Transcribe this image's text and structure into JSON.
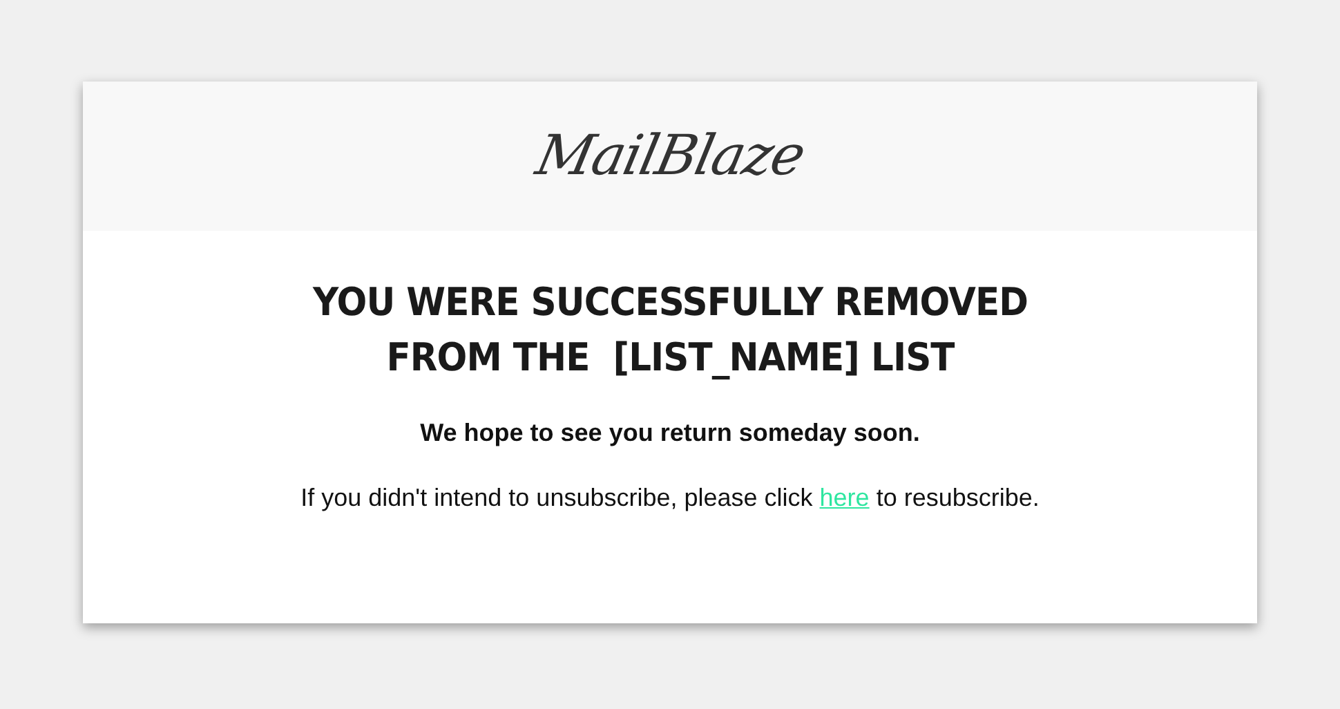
{
  "header": {
    "logo": "MailBlaze"
  },
  "heading_lines": [
    "YOU WERE SUCCESSFULLY REMOVED",
    "FROM THE  [LIST_NAME] LIST"
  ],
  "subheading": "We hope to see you return someday soon.",
  "resubscribe": {
    "before": "If you didn't intend to unsubscribe, please click ",
    "link": "here",
    "after": " to resubscribe."
  }
}
